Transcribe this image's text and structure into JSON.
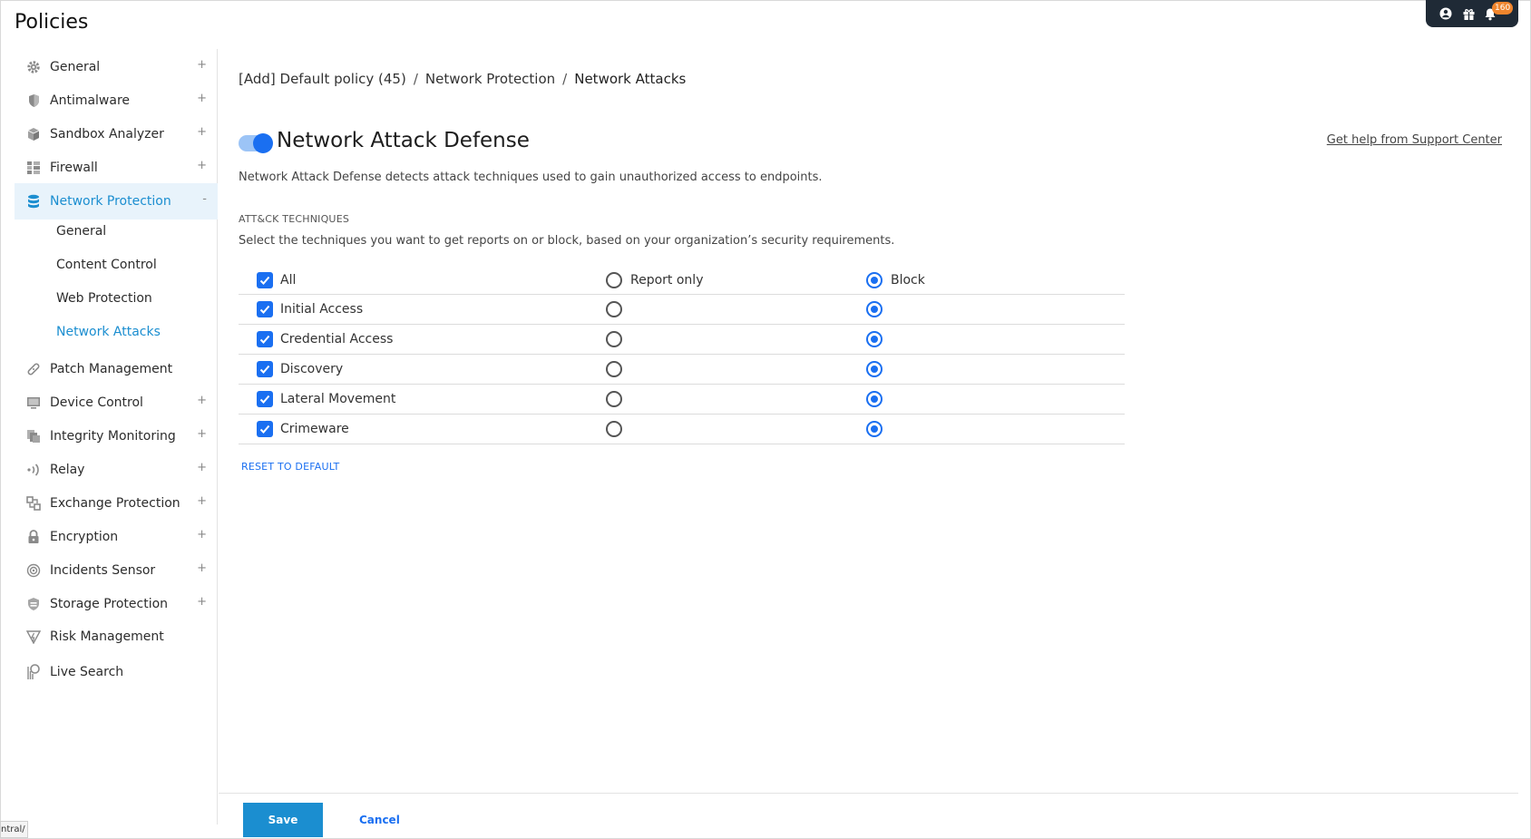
{
  "page": {
    "title": "Policies"
  },
  "topbar": {
    "icons": [
      "user-icon",
      "gift-icon",
      "bell-icon"
    ],
    "notification_count": "160"
  },
  "sidebar": {
    "items": [
      {
        "label": "General",
        "icon": "gear-icon",
        "expander": "+"
      },
      {
        "label": "Antimalware",
        "icon": "shield-icon",
        "expander": "+"
      },
      {
        "label": "Sandbox Analyzer",
        "icon": "cube-icon",
        "expander": "+"
      },
      {
        "label": "Firewall",
        "icon": "firewall-icon",
        "expander": "+"
      },
      {
        "label": "Network Protection",
        "icon": "database-icon",
        "expander": "-"
      },
      {
        "label": "Patch Management",
        "icon": "patch-icon",
        "expander": ""
      },
      {
        "label": "Device Control",
        "icon": "monitor-icon",
        "expander": "+"
      },
      {
        "label": "Integrity Monitoring",
        "icon": "files-icon",
        "expander": "+"
      },
      {
        "label": "Relay",
        "icon": "relay-icon",
        "expander": "+"
      },
      {
        "label": "Exchange Protection",
        "icon": "exchange-icon",
        "expander": "+"
      },
      {
        "label": "Encryption",
        "icon": "lock-icon",
        "expander": "+"
      },
      {
        "label": "Incidents Sensor",
        "icon": "sensor-icon",
        "expander": "+"
      },
      {
        "label": "Storage Protection",
        "icon": "storage-icon",
        "expander": "+"
      },
      {
        "label": "Risk Management",
        "icon": "risk-icon",
        "expander": ""
      },
      {
        "label": "Live Search",
        "icon": "search-icon",
        "expander": ""
      }
    ],
    "subitems": [
      {
        "label": "General"
      },
      {
        "label": "Content Control"
      },
      {
        "label": "Web Protection"
      },
      {
        "label": "Network Attacks"
      }
    ]
  },
  "breadcrumb": {
    "items": [
      "[Add] Default policy (45)",
      "Network Protection",
      "Network Attacks"
    ],
    "separator": "/"
  },
  "section": {
    "title": "Network Attack Defense",
    "enabled": true,
    "help_link": "Get help from Support Center",
    "description": "Network Attack Defense detects attack techniques used to gain unauthorized access to endpoints.",
    "caption": "ATT&CK TECHNIQUES",
    "hint": "Select the techniques you want to get reports on or block, based on your organization’s security requirements."
  },
  "techniques": {
    "header": {
      "label": "All",
      "report_label": "Report only",
      "block_label": "Block"
    },
    "rows": [
      {
        "label": "Initial Access",
        "checked": true,
        "action": "block"
      },
      {
        "label": "Credential Access",
        "checked": true,
        "action": "block"
      },
      {
        "label": "Discovery",
        "checked": true,
        "action": "block"
      },
      {
        "label": "Lateral Movement",
        "checked": true,
        "action": "block"
      },
      {
        "label": "Crimeware",
        "checked": true,
        "action": "block"
      }
    ]
  },
  "reset_label": "RESET TO DEFAULT",
  "footer": {
    "save_label": "Save",
    "cancel_label": "Cancel"
  },
  "statusbar": {
    "text": "ntral/"
  },
  "colors": {
    "accent": "#1a6ff1",
    "nav_active": "#1b8ed0",
    "save_button": "#1b8ed0",
    "badge": "#f0852d",
    "topbar": "#1f2a36"
  }
}
